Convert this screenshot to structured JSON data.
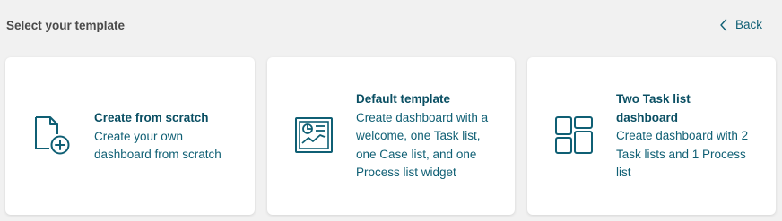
{
  "header": {
    "title": "Select your template",
    "back_label": "Back"
  },
  "cards": [
    {
      "icon": "new-file-plus-icon",
      "title": "Create from scratch",
      "description": "Create your own dashboard from scratch"
    },
    {
      "icon": "dashboard-chart-icon",
      "title": "Default template",
      "description": "Create dashboard with a welcome, one Task list, one Case list, and one Process list widget"
    },
    {
      "icon": "grid-layout-icon",
      "title": "Two Task list dashboard",
      "description": "Create dashboard with 2 Task lists and 1 Process list"
    }
  ],
  "colors": {
    "accent": "#0f5f74",
    "background": "#f1f1f1",
    "card": "#ffffff"
  }
}
